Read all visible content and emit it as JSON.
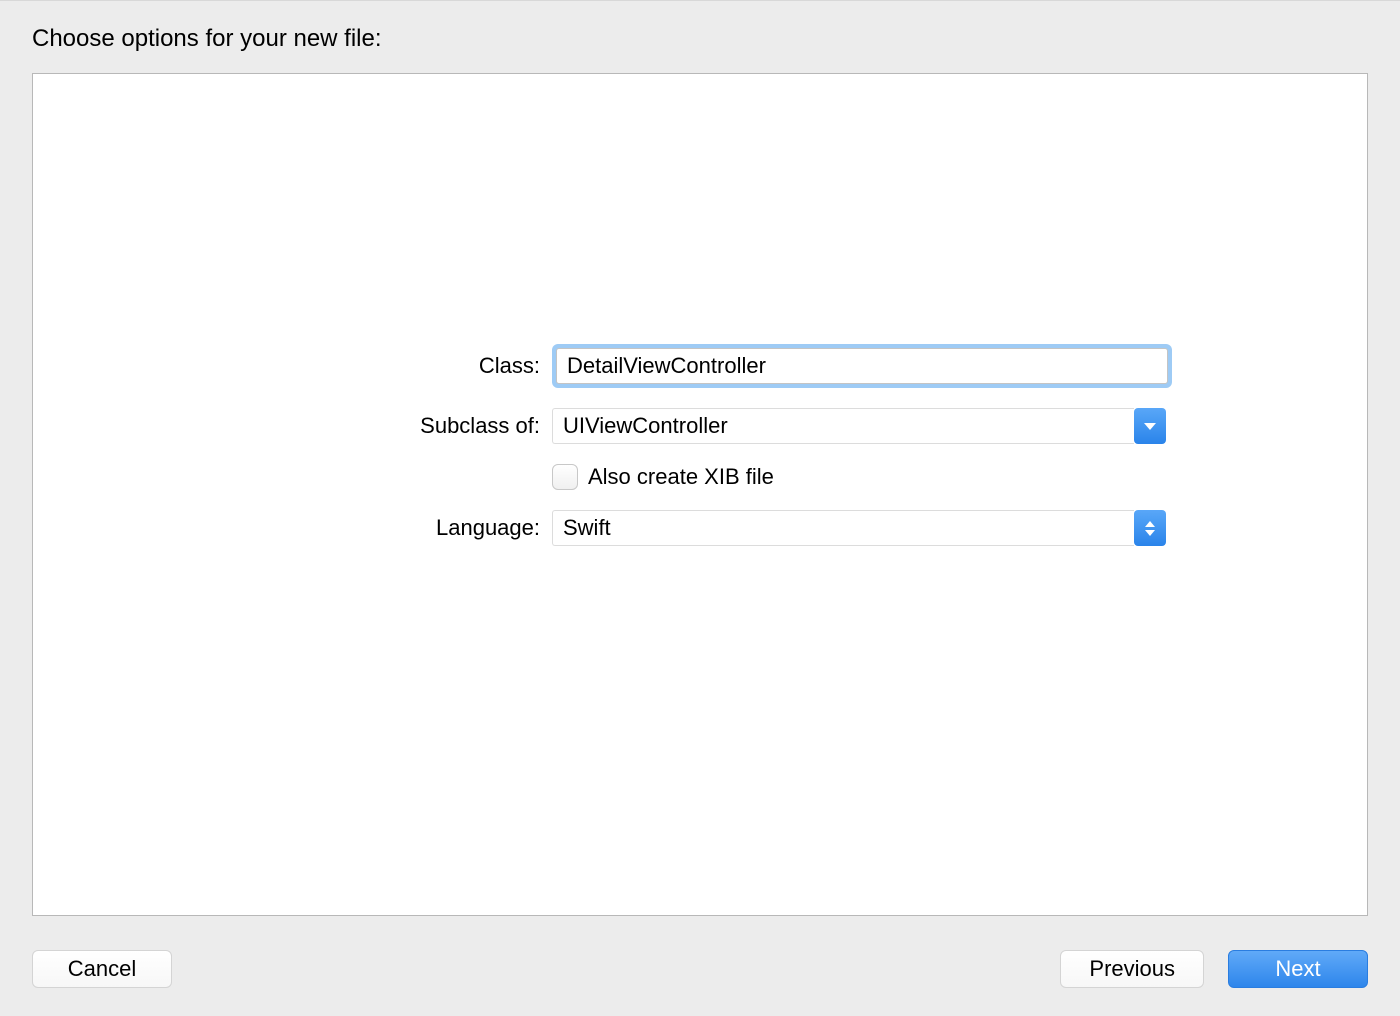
{
  "title": "Choose options for your new file:",
  "form": {
    "class_label": "Class:",
    "class_value": "DetailViewController",
    "subclass_label": "Subclass of:",
    "subclass_value": "UIViewController",
    "xib_label": "Also create XIB file",
    "language_label": "Language:",
    "language_value": "Swift"
  },
  "buttons": {
    "cancel": "Cancel",
    "previous": "Previous",
    "next": "Next"
  }
}
